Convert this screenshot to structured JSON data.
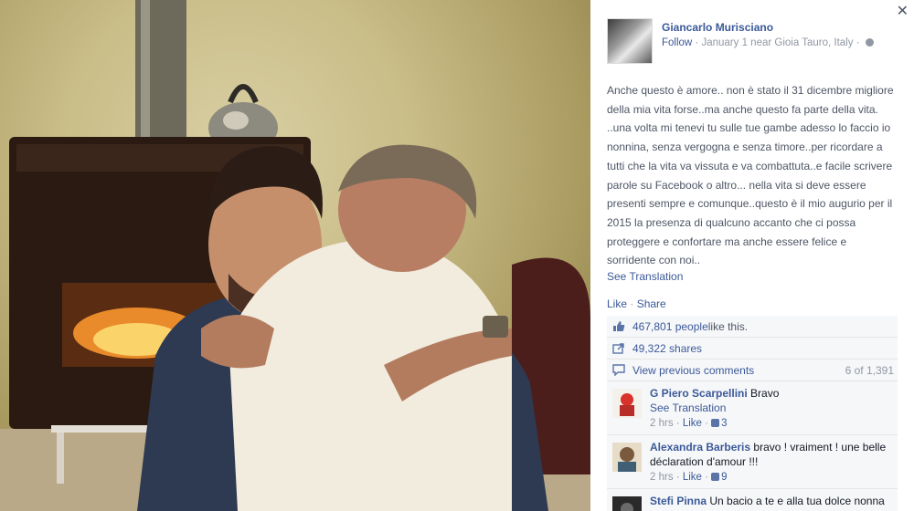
{
  "post": {
    "author": "Giancarlo Murisciano",
    "follow_label": "Follow",
    "date_location": "January 1 near Gioia Tauro, Italy",
    "text": "Anche questo è amore.. non è stato il 31 dicembre migliore della mia vita forse..ma anche questo fa parte della vita. ..una volta mi tenevi tu sulle tue gambe adesso lo faccio io nonnina, senza vergogna e senza timore..per ricordare a tutti che la vita va vissuta e va combattuta..e facile scrivere parole su Facebook o altro... nella vita si deve essere presenti sempre e comunque..questo è il mio augurio per il 2015 la presenza di qualcuno accanto che ci possa proteggere e confortare ma anche essere felice e sorridente con noi..",
    "see_translation": "See Translation",
    "like_label": "Like",
    "share_label": "Share"
  },
  "stats": {
    "likes_count": "467,801 people",
    "likes_suffix": " like this.",
    "shares": "49,322 shares",
    "view_previous": "View previous comments",
    "comment_range": "6 of 1,391"
  },
  "comments": [
    {
      "name": "G Piero Scarpellini",
      "text": " Bravo",
      "translate": "See Translation",
      "time": "2 hrs",
      "like": "Like",
      "likes": "3"
    },
    {
      "name": "Alexandra Barberis",
      "text": " bravo ! vraiment ! une belle déclaration d'amour !!!",
      "time": "2 hrs",
      "like": "Like",
      "likes": "9"
    },
    {
      "name": "Stefi Pinna",
      "text": " Un bacio a te e alla tua dolce nonna dalla Sardegna"
    }
  ],
  "ui": {
    "close": "✕",
    "separator": " · "
  },
  "colors": {
    "link": "#3b5998",
    "muted": "#9197a3",
    "text": "#4e5665"
  }
}
